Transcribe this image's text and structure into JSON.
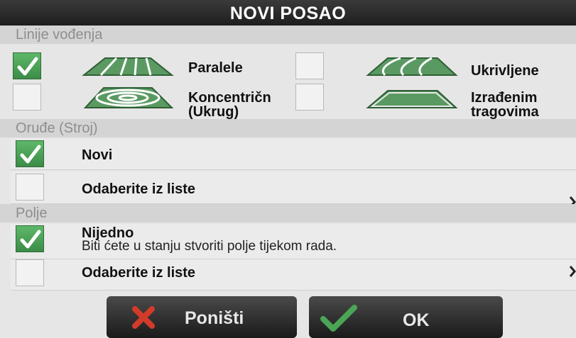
{
  "title": "NOVI POSAO",
  "guidance_section": {
    "header": "Linije vođenja",
    "options": [
      {
        "label": "Paralele",
        "checked": true,
        "icon": "parallel-lines-icon"
      },
      {
        "label": "Ukrivljene",
        "checked": false,
        "icon": "curved-lines-icon"
      },
      {
        "label_line1": "Koncentričn",
        "label_line2": "(Ukrug)",
        "checked": false,
        "icon": "concentric-circles-icon"
      },
      {
        "label_line1": "Izrađenim",
        "label_line2": "tragovima",
        "checked": false,
        "icon": "trapezoid-track-icon"
      }
    ]
  },
  "implement_section": {
    "header": "Oruđe (Stroj)",
    "rows": [
      {
        "label": "Novi",
        "checked": true
      },
      {
        "label": "Odaberite iz liste",
        "checked": false
      }
    ]
  },
  "field_section": {
    "header": "Polje",
    "rows": [
      {
        "label": "Nijedno",
        "sublabel": "Biti ćete u stanju stvoriti polje tijekom rada.",
        "checked": true
      },
      {
        "label": "Odaberite iz liste",
        "checked": false
      }
    ]
  },
  "buttons": {
    "cancel": "Poništi",
    "ok": "OK"
  },
  "colors": {
    "check_green": "#4aa656",
    "cancel_red": "#d23a2a",
    "title_bg": "#1e1e1e"
  }
}
